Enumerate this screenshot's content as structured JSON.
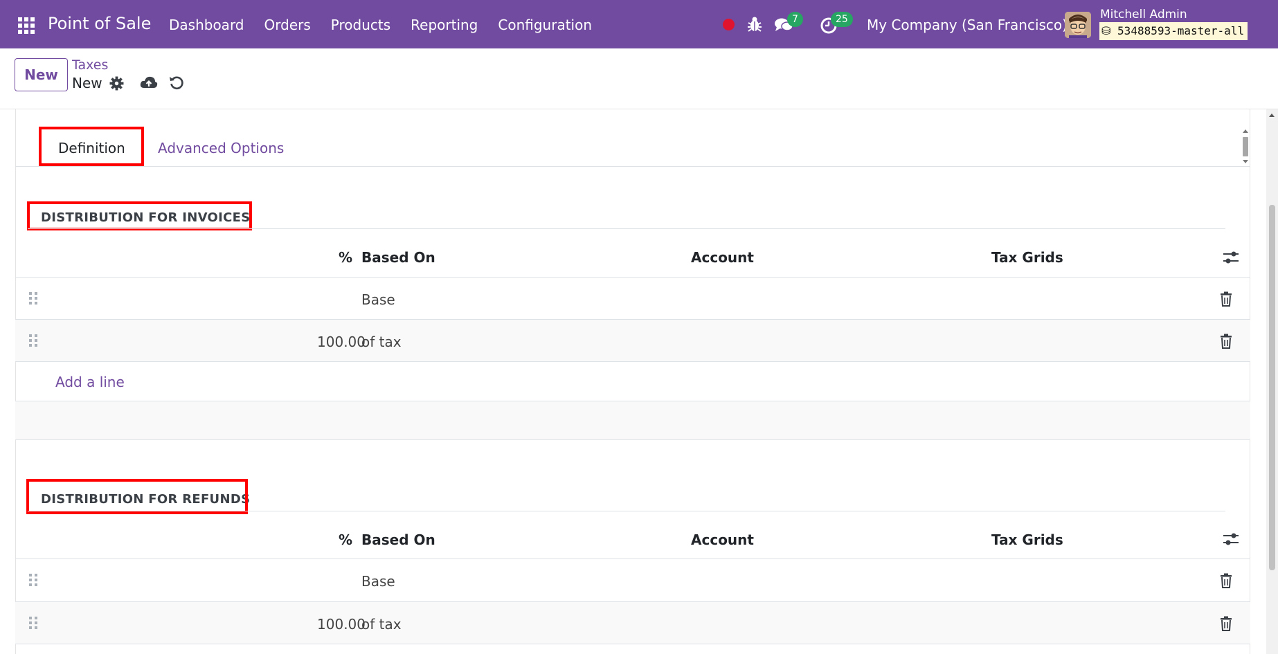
{
  "navbar": {
    "app_title": "Point of Sale",
    "menu": [
      "Dashboard",
      "Orders",
      "Products",
      "Reporting",
      "Configuration"
    ],
    "chat_badge": "7",
    "activity_badge": "25",
    "company": "My Company (San Francisco)",
    "user_name": "Mitchell Admin",
    "database": "53488593-master-all",
    "brand_color": "#714b9f",
    "record_color": "#e0142e",
    "badge_color": "#26a563"
  },
  "control_panel": {
    "new_button": "New",
    "breadcrumb_parent": "Taxes",
    "breadcrumb_current": "New"
  },
  "tabs": [
    "Definition",
    "Advanced Options"
  ],
  "highlight_color": "#ff0000",
  "invoices": {
    "title": "DISTRIBUTION FOR INVOICES",
    "columns": [
      "%",
      "Based On",
      "Account",
      "Tax Grids"
    ],
    "rows": [
      {
        "percent": "",
        "based_on": "Base",
        "account": "",
        "tax_grids": ""
      },
      {
        "percent": "100.00",
        "based_on": "of tax",
        "account": "",
        "tax_grids": ""
      }
    ],
    "add_line": "Add a line"
  },
  "refunds": {
    "title": "DISTRIBUTION FOR REFUNDS",
    "columns": [
      "%",
      "Based On",
      "Account",
      "Tax Grids"
    ],
    "rows": [
      {
        "percent": "",
        "based_on": "Base",
        "account": "",
        "tax_grids": ""
      },
      {
        "percent": "100.00",
        "based_on": "of tax",
        "account": "",
        "tax_grids": ""
      }
    ]
  }
}
